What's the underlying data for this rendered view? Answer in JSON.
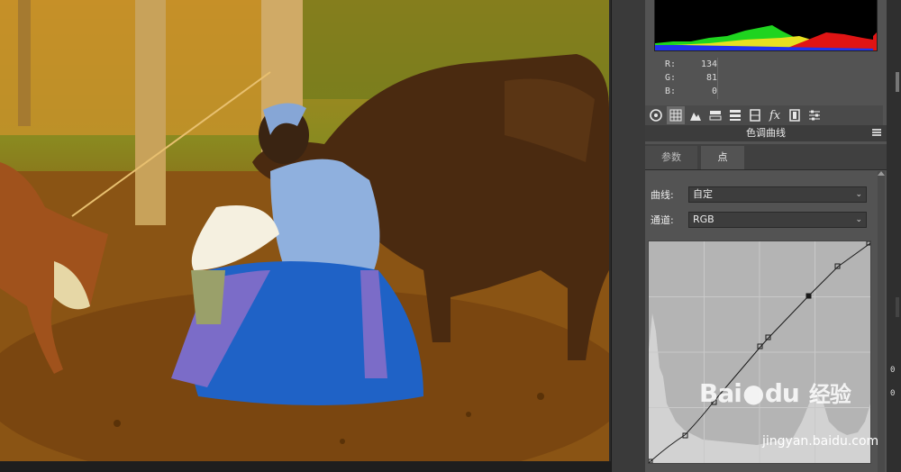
{
  "info": {
    "r_label": "R:",
    "r_value": "134",
    "g_label": "G:",
    "g_value": "81",
    "b_label": "B:",
    "b_value": "0"
  },
  "panel": {
    "title": "色调曲线",
    "tabs": [
      {
        "label": "参数"
      },
      {
        "label": "点"
      }
    ],
    "curve": {
      "label": "曲线:",
      "value": "自定"
    },
    "channel": {
      "label": "通道:",
      "value": "RGB"
    }
  },
  "side_numbers": [
    "0",
    "0"
  ],
  "watermark": {
    "brand": "Bai",
    "brand2": "du",
    "cn": "经验",
    "url": "jingyan.baidu.com"
  },
  "colors": {
    "panel_bg": "#535353",
    "curve_bg": "#b4b4b4",
    "photo_tone": "#c8901a"
  },
  "icons": [
    "aperture-icon",
    "grid-icon",
    "mountain-icon",
    "split-tone-icon",
    "hsl-icon",
    "lens-icon",
    "fx-icon",
    "film-icon",
    "sliders-icon"
  ]
}
